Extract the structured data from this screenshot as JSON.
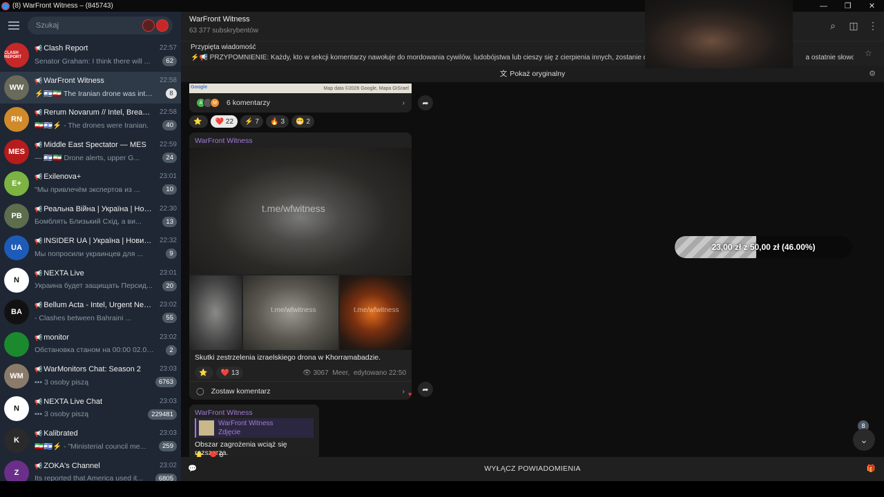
{
  "window": {
    "title": "(8) WarFront Witness – (845743)"
  },
  "search": {
    "placeholder": "Szukaj"
  },
  "chats": [
    {
      "name": "Clash Report",
      "time": "22:57",
      "preview": "Senator Graham: I think there will ...",
      "count": "62",
      "avatar_text": "CLASH REPORT",
      "avatar_color": "#c62828"
    },
    {
      "name": "WarFront Witness",
      "time": "22:58",
      "preview": "⚡🇮🇱🇮🇷 The Iranian drone was interc...",
      "count": "8",
      "avatar_text": "WW",
      "avatar_color": "#6a6a5a",
      "active": true
    },
    {
      "name": "Rerum Novarum // Intel, Breakin...",
      "time": "22:58",
      "preview": "🇮🇷🇮🇱⚡ - The drones were Iranian.",
      "count": "40",
      "avatar_text": "RN",
      "avatar_color": "#d08a2a"
    },
    {
      "name": "Middle East Spectator — MES",
      "time": "22:59",
      "preview": "— 🇮🇱🇮🇷 Drone alerts, upper G...",
      "count": "24",
      "avatar_text": "MES",
      "avatar_color": "#b71c1c"
    },
    {
      "name": "Exilenova+",
      "time": "23:01",
      "preview": "\"Мы привлечём экспертов из ...",
      "count": "10",
      "avatar_text": "E+",
      "avatar_color": "#7cb342"
    },
    {
      "name": "Реальна Війна | Україна | Нови...",
      "time": "22:30",
      "preview": "Бомблять Близький Схід, а ви...",
      "count": "13",
      "avatar_text": "РВ",
      "avatar_color": "#5d6d4e"
    },
    {
      "name": "INSIDER UA | Україна | Новини",
      "time": "22:32",
      "preview": "Мы попросили украинцев для ...",
      "count": "9",
      "avatar_text": "UA",
      "avatar_color": "#1e5bb8"
    },
    {
      "name": "NEXTA Live",
      "time": "23:01",
      "preview": "Украина будет защищать Персид...",
      "count": "20",
      "avatar_text": "N",
      "avatar_color": "#ffffff"
    },
    {
      "name": "Bellum Acta - Intel, Urgent News ...",
      "time": "23:02",
      "preview": "- Clashes between Bahraini ...",
      "count": "55",
      "avatar_text": "BA",
      "avatar_color": "#111111"
    },
    {
      "name": "monitor",
      "time": "23:02",
      "preview": "Обстановка станом на 00:00 02.03....",
      "count": "2",
      "avatar_text": "",
      "avatar_color": "#1b8a2e"
    },
    {
      "name": "WarMonitors Chat: Season 2",
      "time": "23:03",
      "preview": "••• 3 osoby piszą",
      "count": "6763",
      "avatar_text": "WM",
      "avatar_color": "#8a7a6a"
    },
    {
      "name": "NEXTA Live Chat",
      "time": "23:03",
      "preview": "••• 3 osoby piszą",
      "count": "229481",
      "avatar_text": "N",
      "avatar_color": "#ffffff"
    },
    {
      "name": "Kalibrated",
      "time": "23:03",
      "preview": "🇮🇷🇮🇱⚡ - \"Ministerial council me...",
      "count": "259",
      "avatar_text": "K",
      "avatar_color": "#2a2a2a"
    },
    {
      "name": "ZOKA's Channel",
      "time": "23:02",
      "preview": "Its reported that America used it...",
      "count": "6805",
      "avatar_text": "Z",
      "avatar_color": "#6b2f8a"
    }
  ],
  "header": {
    "title": "WarFront Witness",
    "subscribers": "63 377 subskrybentów"
  },
  "pinned": {
    "label": "Przypięta wiadomość",
    "text": "⚡📢 PRZYPOMNIENIE: Każdy, kto w sekcji komentarzy nawołuje do mordowania cywilów, ludobójstwa lub cieszy się z cierpienia innych, zostanie c",
    "text_end": "a ostatnie słowo. ..."
  },
  "translate": {
    "label": "Pokaż oryginalny"
  },
  "post1": {
    "map_credit": "Map data ©2026 Google, Mapa GISrael",
    "comments": "6 komentarzy",
    "reactions": [
      {
        "emoji": "⭐",
        "count": ""
      },
      {
        "emoji": "❤️",
        "count": "22",
        "mine": true
      },
      {
        "emoji": "⚡",
        "count": "7"
      },
      {
        "emoji": "🔥",
        "count": "3"
      },
      {
        "emoji": "😁",
        "count": "2"
      }
    ]
  },
  "post2": {
    "sender": "WarFront Witness",
    "watermark": "t.me/wfwitness",
    "caption": "Skutki zestrzelenia izraelskiego drona w Khorramabadzie.",
    "reactions": [
      {
        "emoji": "⭐",
        "count": ""
      },
      {
        "emoji": "❤️",
        "count": "13"
      }
    ],
    "views": "3067",
    "author": "Meer,",
    "edited": "edytowano 22:50",
    "comment_cta": "Zostaw komentarz"
  },
  "post3": {
    "sender": "WarFront Witness",
    "reply_name": "WarFront Witness",
    "reply_type": "Zdjęcie",
    "text": "Obszar zagrożenia wciąż się rozszerza.",
    "reaction_count": "8"
  },
  "donation": {
    "label": "23,00 zł z 50,00 zł (46.00%)",
    "fraction": 0.46
  },
  "footer": {
    "mute": "WYŁĄCZ POWIADOMIENIA"
  },
  "scroll_badge": "8"
}
